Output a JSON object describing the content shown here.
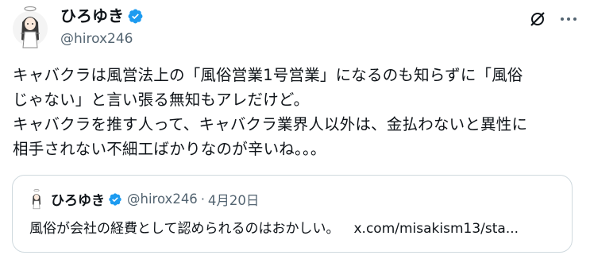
{
  "author": {
    "display_name": "ひろゆき",
    "handle": "@hirox246",
    "avatar_icon": "avatar-illustration",
    "verified_icon": "verified-badge-icon"
  },
  "actions": {
    "grok_icon": "grok-icon",
    "more_icon": "more-options-icon"
  },
  "tweet": {
    "lines": [
      "キャバクラは風営法上の「風俗営業1号営業」になるのも知らずに「風俗",
      "じゃない」と言い張る無知もアレだけど。",
      "キャバクラを推す人って、キャバクラ業界人以外は、金払わないと異性に",
      "相手されない不細工ばかりなのが辛いね。。。"
    ]
  },
  "quoted": {
    "display_name": "ひろゆき",
    "handle": "@hirox246",
    "separator": "·",
    "date": "4月20日",
    "text": "風俗が会社の経費として認められるのはおかしい。",
    "link": "x.com/misakism13/sta..."
  },
  "colors": {
    "verified": "#1d9bf0",
    "text_primary": "#0f1419",
    "text_secondary": "#536471",
    "border": "#cfd9de"
  }
}
